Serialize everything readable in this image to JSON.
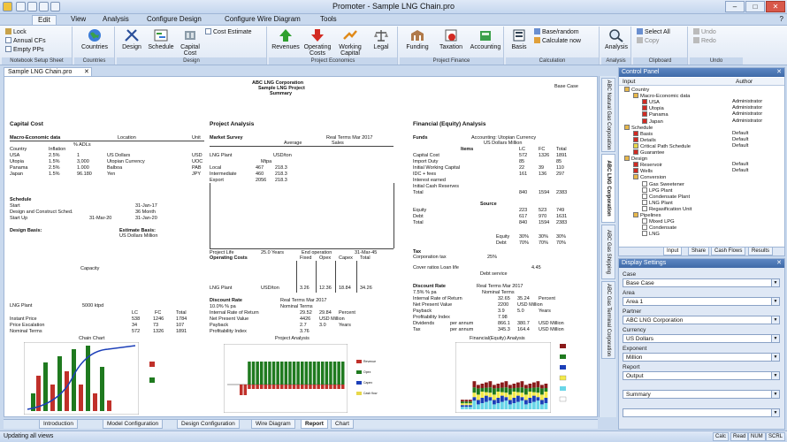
{
  "window": {
    "title": "Promoter - Sample LNG Chain.pro",
    "min": "–",
    "max": "□",
    "close": "✕"
  },
  "ribbon_tabs": [
    "Edit",
    "View",
    "Analysis",
    "Configure Design",
    "Configure Wire Diagram",
    "Tools"
  ],
  "ribbon": {
    "options": {
      "lock": "Lock",
      "annual_cfs": "Annual CFs",
      "empty_pps": "Empty PPs",
      "label": "Notebook Setup Sheet"
    },
    "countries": {
      "label": "Countries",
      "group": "Countries"
    },
    "design": {
      "design": "Design",
      "schedule": "Schedule",
      "capital_cost": "Capital Cost",
      "cost_estimate": "Cost Estimate",
      "group": "Design"
    },
    "commercial": {
      "revenues": "Revenues",
      "operating_costs": "Operating Costs",
      "working_capital": "Working Capital",
      "legal": "Legal",
      "group": "Project Economics"
    },
    "finance": {
      "funding": "Funding",
      "taxation": "Taxation",
      "accounting": "Accounting",
      "group": "Project Finance"
    },
    "calculation": {
      "basis": "Basis",
      "base_random": "Base/random",
      "calculate_now": "Calculate now",
      "group": "Calculation"
    },
    "analysis": {
      "analysis": "Analysis",
      "group": "Analysis"
    },
    "clipboard": {
      "select_all": "Select All",
      "copy": "Copy",
      "group": "Clipboard"
    },
    "undo": {
      "undo": "Undo",
      "redo": "Redo",
      "group": "Undo"
    }
  },
  "document_tab": "Sample LNG Chain.pro",
  "report": {
    "header_line1": "ABC LNG Corporation",
    "header_line2": "Sample LNG Project",
    "header_line3": "Summary",
    "header_right": "Base Case",
    "capital_cost": {
      "title": "Capital Cost",
      "macro_label": "Macro-Economic data",
      "location_label": "Location",
      "unit_label": "Unit",
      "subhead": "% ADLs",
      "country_col": "Country",
      "inflation_col": "Inflation",
      "rows": [
        [
          "USA",
          "2.5%",
          "1",
          "US Dollars",
          "USD"
        ],
        [
          "Utopia",
          "1.5%",
          "3,000",
          "Utopian Currency",
          "UOC"
        ],
        [
          "Panama",
          "2.5%",
          "1.000",
          "Balboa",
          "PAB"
        ],
        [
          "Japan",
          "1.5%",
          "96.180",
          "Yen",
          "JPY"
        ]
      ],
      "schedule_label": "Schedule",
      "schedule_rows": [
        [
          "Start",
          "31-Jan-17"
        ],
        [
          "Design and Construct Sched.",
          "36 Month"
        ],
        [
          "Start Up",
          "31-Jan-20",
          "31-Mar-20"
        ]
      ],
      "design_basis": "Design Basis:",
      "estimate_basis": "Estimate Basis:",
      "estimate_currency": "US Dollars Million",
      "capacity": "Capacity",
      "lng_plant": "LNG Plant",
      "lng_plant_cap": "5000 ktpd",
      "cost_cols": [
        "LC",
        "FC",
        "Total"
      ],
      "cost_rows": [
        [
          "Instant Price",
          "538",
          "1246",
          "1784"
        ],
        [
          "Price Escalation",
          "34",
          "73",
          "107"
        ],
        [
          "Nominal Terms",
          "572",
          "1326",
          "1891"
        ]
      ],
      "chart_title": "Chain Chart"
    },
    "project_analysis": {
      "title": "Project Analysis",
      "market_survey": "Market Survey",
      "terms": "Real Terms Mar 2017",
      "average": "Average",
      "sales": "Sales",
      "plant_label": "LNG Plant",
      "plant_unit": "USD/ton",
      "cols": [
        "Mtpa"
      ],
      "rows": [
        [
          "Local",
          "467",
          "218.3"
        ],
        [
          "Intermediate",
          "460",
          "218.3"
        ],
        [
          "Export",
          "2056",
          "218.3"
        ]
      ],
      "project_life": "Project Life",
      "life_val": "25.0 Years",
      "end_op": "End operation",
      "end_val": "31-Mar-45",
      "opcosts": "Operating Costs",
      "op_cols": [
        "Fixed",
        "Opex",
        "Capex",
        "Total"
      ],
      "op_row": [
        "LNG Plant",
        "USD/ton",
        "3.26",
        "12.36",
        "18.84",
        "34.26"
      ],
      "disc_rate": "Discount Rate",
      "disc_terms": "Real Terms Mar 2017",
      "disc_val": "10.0% % pa",
      "nominal": "Nominal Terms",
      "irr": "Internal Rate of Return",
      "irr_vals": [
        "29.52",
        "29.84",
        "Percent"
      ],
      "npv": "Net Present Value",
      "npv_vals": [
        "4426",
        "USD Million"
      ],
      "payback": "Payback",
      "payback_vals": [
        "2.7",
        "3.0",
        "Years"
      ],
      "pi": "Profitability Index",
      "pi_vals": [
        "3.76"
      ],
      "chart_title": "Project Analysis",
      "legend": [
        "Revenue",
        "Opex",
        "Capex",
        "Cash flow"
      ]
    },
    "financial": {
      "title": "Financial (Equity) Analysis",
      "funds": "Funds",
      "currency": "Accounting: Utopian Currency",
      "currency2": "US Dollars Million",
      "items_head": "Items",
      "cols": [
        "LC",
        "FC",
        "Total"
      ],
      "rows": [
        [
          "Capital Cost",
          "572",
          "1326",
          "1891"
        ],
        [
          "Import Duty",
          "85",
          "",
          "85"
        ],
        [
          "Initial Working Capital",
          "22",
          "39",
          "110"
        ],
        [
          "IDC + fees",
          "161",
          "136",
          "297"
        ],
        [
          "Interest earned",
          "",
          "",
          ""
        ],
        [
          "Initial Cash Reserves",
          "",
          "",
          ""
        ],
        [
          "Total",
          "840",
          "1594",
          "2383"
        ]
      ],
      "source": "Source",
      "src_rows": [
        [
          "Equity",
          "223",
          "523",
          "749"
        ],
        [
          "Debt",
          "617",
          "970",
          "1631"
        ],
        [
          "Total",
          "840",
          "1594",
          "2383"
        ]
      ],
      "ratio_rows": [
        [
          "Equity",
          "30%",
          "30%",
          "30%"
        ],
        [
          "Debt",
          "70%",
          "70%",
          "70%"
        ]
      ],
      "tax": "Tax",
      "corp_tax": "Corporation tax",
      "corp_tax_val": "25%",
      "cover": "Cover ratios Loan life",
      "cover_val": "4.45",
      "debt_service": "Debt service",
      "disc_rate": "Discount Rate",
      "disc_terms": "Real Terms Mar 2017",
      "disc_val": "7.5% % pa",
      "nominal": "Nominal Terms",
      "irr": "Internal Rate of Return",
      "irr_vals": [
        "32.65",
        "35.24",
        "Percent"
      ],
      "npv": "Net Present Value",
      "npv_vals": [
        "2200",
        "USD Million"
      ],
      "payback": "Payback",
      "payback_vals": [
        "3.9",
        "5.0",
        "Years"
      ],
      "pi": "Profitability Index",
      "pi_vals": [
        "7.98"
      ],
      "div": "Dividends",
      "div_unit": "per annum",
      "div_vals": [
        "866.1",
        "380.7",
        "USD Million"
      ],
      "taxrow": "Tax",
      "tax_unit": "per annum",
      "tax_vals": [
        "345.3",
        "164.4",
        "USD Million"
      ],
      "chart_title": "Financial(Equity) Analysis"
    }
  },
  "right_vtabs": [
    "ABC Natural Gas Corporation",
    "ABC LNG Corporation",
    "ABC Gas Shipping",
    "ABC Gas Terminal Corporation"
  ],
  "sheet_tabs": [
    "Introduction",
    "Model Configuration",
    "Design Configuration",
    "Wire Diagram",
    "Report",
    "Chart"
  ],
  "status": {
    "text": "Updating all views",
    "boxes": [
      "Calc",
      "Read",
      "NUM",
      "SCRL"
    ]
  },
  "control_panel": {
    "title": "Control Panel",
    "col_input": "Input",
    "col_author": "Author",
    "tree": [
      {
        "level": 0,
        "label": "Country",
        "author": "",
        "icon": "folder"
      },
      {
        "level": 1,
        "label": "Macro-Economic data",
        "author": "",
        "icon": "folder"
      },
      {
        "level": 2,
        "label": "USA",
        "author": "Administrator",
        "icon": "x"
      },
      {
        "level": 2,
        "label": "Utopia",
        "author": "Administrator",
        "icon": "x"
      },
      {
        "level": 2,
        "label": "Panama",
        "author": "Administrator",
        "icon": "x"
      },
      {
        "level": 2,
        "label": "Japan",
        "author": "Administrator",
        "icon": "x"
      },
      {
        "level": 0,
        "label": "Schedule",
        "author": "",
        "icon": "folder"
      },
      {
        "level": 1,
        "label": "Basis",
        "author": "Default",
        "icon": "x"
      },
      {
        "level": 1,
        "label": "Details",
        "author": "Default",
        "icon": "x"
      },
      {
        "level": 1,
        "label": "Critical Path Schedule",
        "author": "Default",
        "icon": "ok"
      },
      {
        "level": 1,
        "label": "Guarantee",
        "author": "",
        "icon": "x"
      },
      {
        "level": 0,
        "label": "Design",
        "author": "",
        "icon": "folder"
      },
      {
        "level": 1,
        "label": "Reservoir",
        "author": "Default",
        "icon": "x"
      },
      {
        "level": 1,
        "label": "Wells",
        "author": "Default",
        "icon": "x"
      },
      {
        "level": 1,
        "label": "Conversion",
        "author": "",
        "icon": "folder"
      },
      {
        "level": 2,
        "label": "Gas Sweetener",
        "author": "",
        "icon": "doc"
      },
      {
        "level": 2,
        "label": "LPG Plant",
        "author": "",
        "icon": "doc"
      },
      {
        "level": 2,
        "label": "Condensate Plant",
        "author": "",
        "icon": "doc"
      },
      {
        "level": 2,
        "label": "LNG Plant",
        "author": "",
        "icon": "doc"
      },
      {
        "level": 2,
        "label": "Regasification Unit",
        "author": "",
        "icon": "doc"
      },
      {
        "level": 1,
        "label": "Pipelines",
        "author": "",
        "icon": "folder"
      },
      {
        "level": 2,
        "label": "Mixed LPG",
        "author": "",
        "icon": "doc"
      },
      {
        "level": 2,
        "label": "Condensate",
        "author": "",
        "icon": "doc"
      },
      {
        "level": 2,
        "label": "LNG",
        "author": "",
        "icon": "doc"
      }
    ],
    "tabs": [
      "Input",
      "Share",
      "Cash Flows",
      "Results"
    ]
  },
  "display_settings": {
    "title": "Display Settings",
    "fields": [
      {
        "label": "Case",
        "value": "Base Case"
      },
      {
        "label": "Area",
        "value": "Area 1"
      },
      {
        "label": "Partner",
        "value": "ABC LNG Corporation"
      },
      {
        "label": "Currency",
        "value": "US Dollars"
      },
      {
        "label": "Exponent",
        "value": "Million"
      },
      {
        "label": "Report",
        "value": "Output"
      },
      {
        "label": "",
        "value": "Summary"
      },
      {
        "label": "",
        "value": ""
      }
    ]
  },
  "colors": {
    "accent": "#3f6aa8",
    "ribbon": "#dfe8f5",
    "green": "#1f7a1f",
    "red": "#c0302a",
    "blue": "#1c3fb8"
  }
}
